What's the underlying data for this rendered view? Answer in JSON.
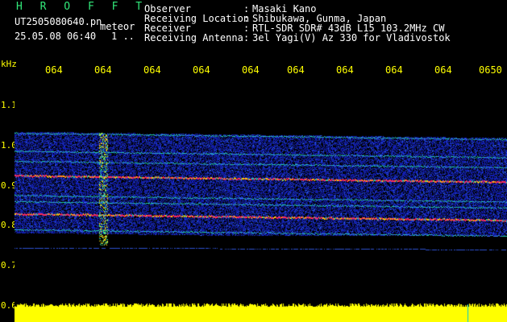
{
  "header": {
    "title": "H R O F F T",
    "filename": "UT2505080640.pn",
    "meteor": "meteor",
    "datetime": "25.05.08 06:40",
    "marker": "1 .."
  },
  "meta": [
    {
      "key": "Observer",
      "sep": ":",
      "value": "Masaki Kano"
    },
    {
      "key": "Receiving Location",
      "sep": ":",
      "value": "Shibukawa, Gunma, Japan"
    },
    {
      "key": "Receiver",
      "sep": ":",
      "value": "RTL-SDR SDR# 43dB L15 103.2MHz CW"
    },
    {
      "key": "Receiving Antenna",
      "sep": ":",
      "value": "3el Yagi(V) Az 330 for Vladivostok"
    }
  ],
  "axis": {
    "yunit": "kHz",
    "yticks": [
      "1.1",
      "1.0",
      "0.9",
      "0.8",
      "0.7",
      "0.6"
    ],
    "xticks": [
      "064",
      "064",
      "064",
      "064",
      "064",
      "064",
      "064",
      "064",
      "064",
      "0650"
    ]
  },
  "colors": {
    "background": "#000000",
    "labels": "#ffff00",
    "title": "#32e87a",
    "text": "#ffffff",
    "noise": "#1530c8",
    "carrier_strong": "#ff2a5a",
    "carrier_mid": "#20d0a0",
    "amplitude": "#ffff00"
  },
  "spectrogram": {
    "carriers_khz": [
      1.03,
      0.985,
      0.96,
      0.925,
      0.875,
      0.86,
      0.83,
      0.79
    ],
    "strong_carriers_khz": [
      0.925,
      0.83
    ],
    "meteor_burst_minute_fraction": 0.18
  }
}
